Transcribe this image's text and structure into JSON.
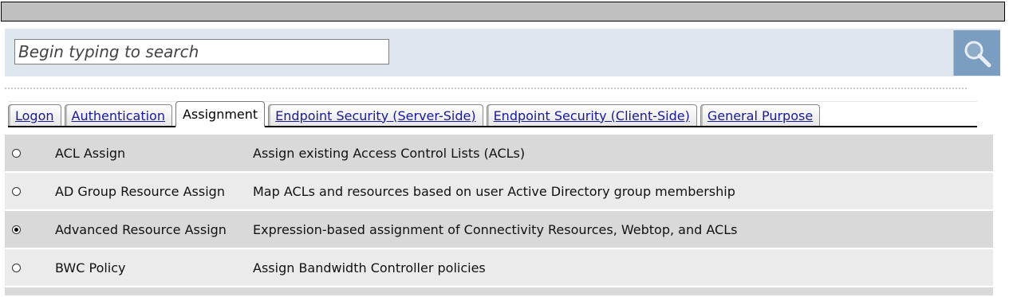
{
  "search": {
    "placeholder": "Begin typing to search",
    "value": ""
  },
  "tabs": [
    {
      "label": "Logon",
      "active": false
    },
    {
      "label": "Authentication",
      "active": false
    },
    {
      "label": "Assignment",
      "active": true
    },
    {
      "label": "Endpoint Security (Server-Side)",
      "active": false
    },
    {
      "label": "Endpoint Security (Client-Side)",
      "active": false
    },
    {
      "label": "General Purpose",
      "active": false
    }
  ],
  "items": [
    {
      "name": "ACL Assign",
      "description": "Assign existing Access Control Lists (ACLs)",
      "selected": false
    },
    {
      "name": "AD Group Resource Assign",
      "description": "Map ACLs and resources based on user Active Directory group membership",
      "selected": false
    },
    {
      "name": "Advanced Resource Assign",
      "description": "Expression-based assignment of Connectivity Resources, Webtop, and ACLs",
      "selected": true
    },
    {
      "name": "BWC Policy",
      "description": "Assign Bandwidth Controller policies",
      "selected": false
    }
  ],
  "icons": {
    "search_button": "magnifier-icon"
  },
  "colors": {
    "search_bar_bg": "#dfe6ee",
    "search_button_bg": "#7b9dbf",
    "row_odd": "#d9d9d9",
    "row_even": "#ebebeb",
    "link": "#1a1a99"
  }
}
